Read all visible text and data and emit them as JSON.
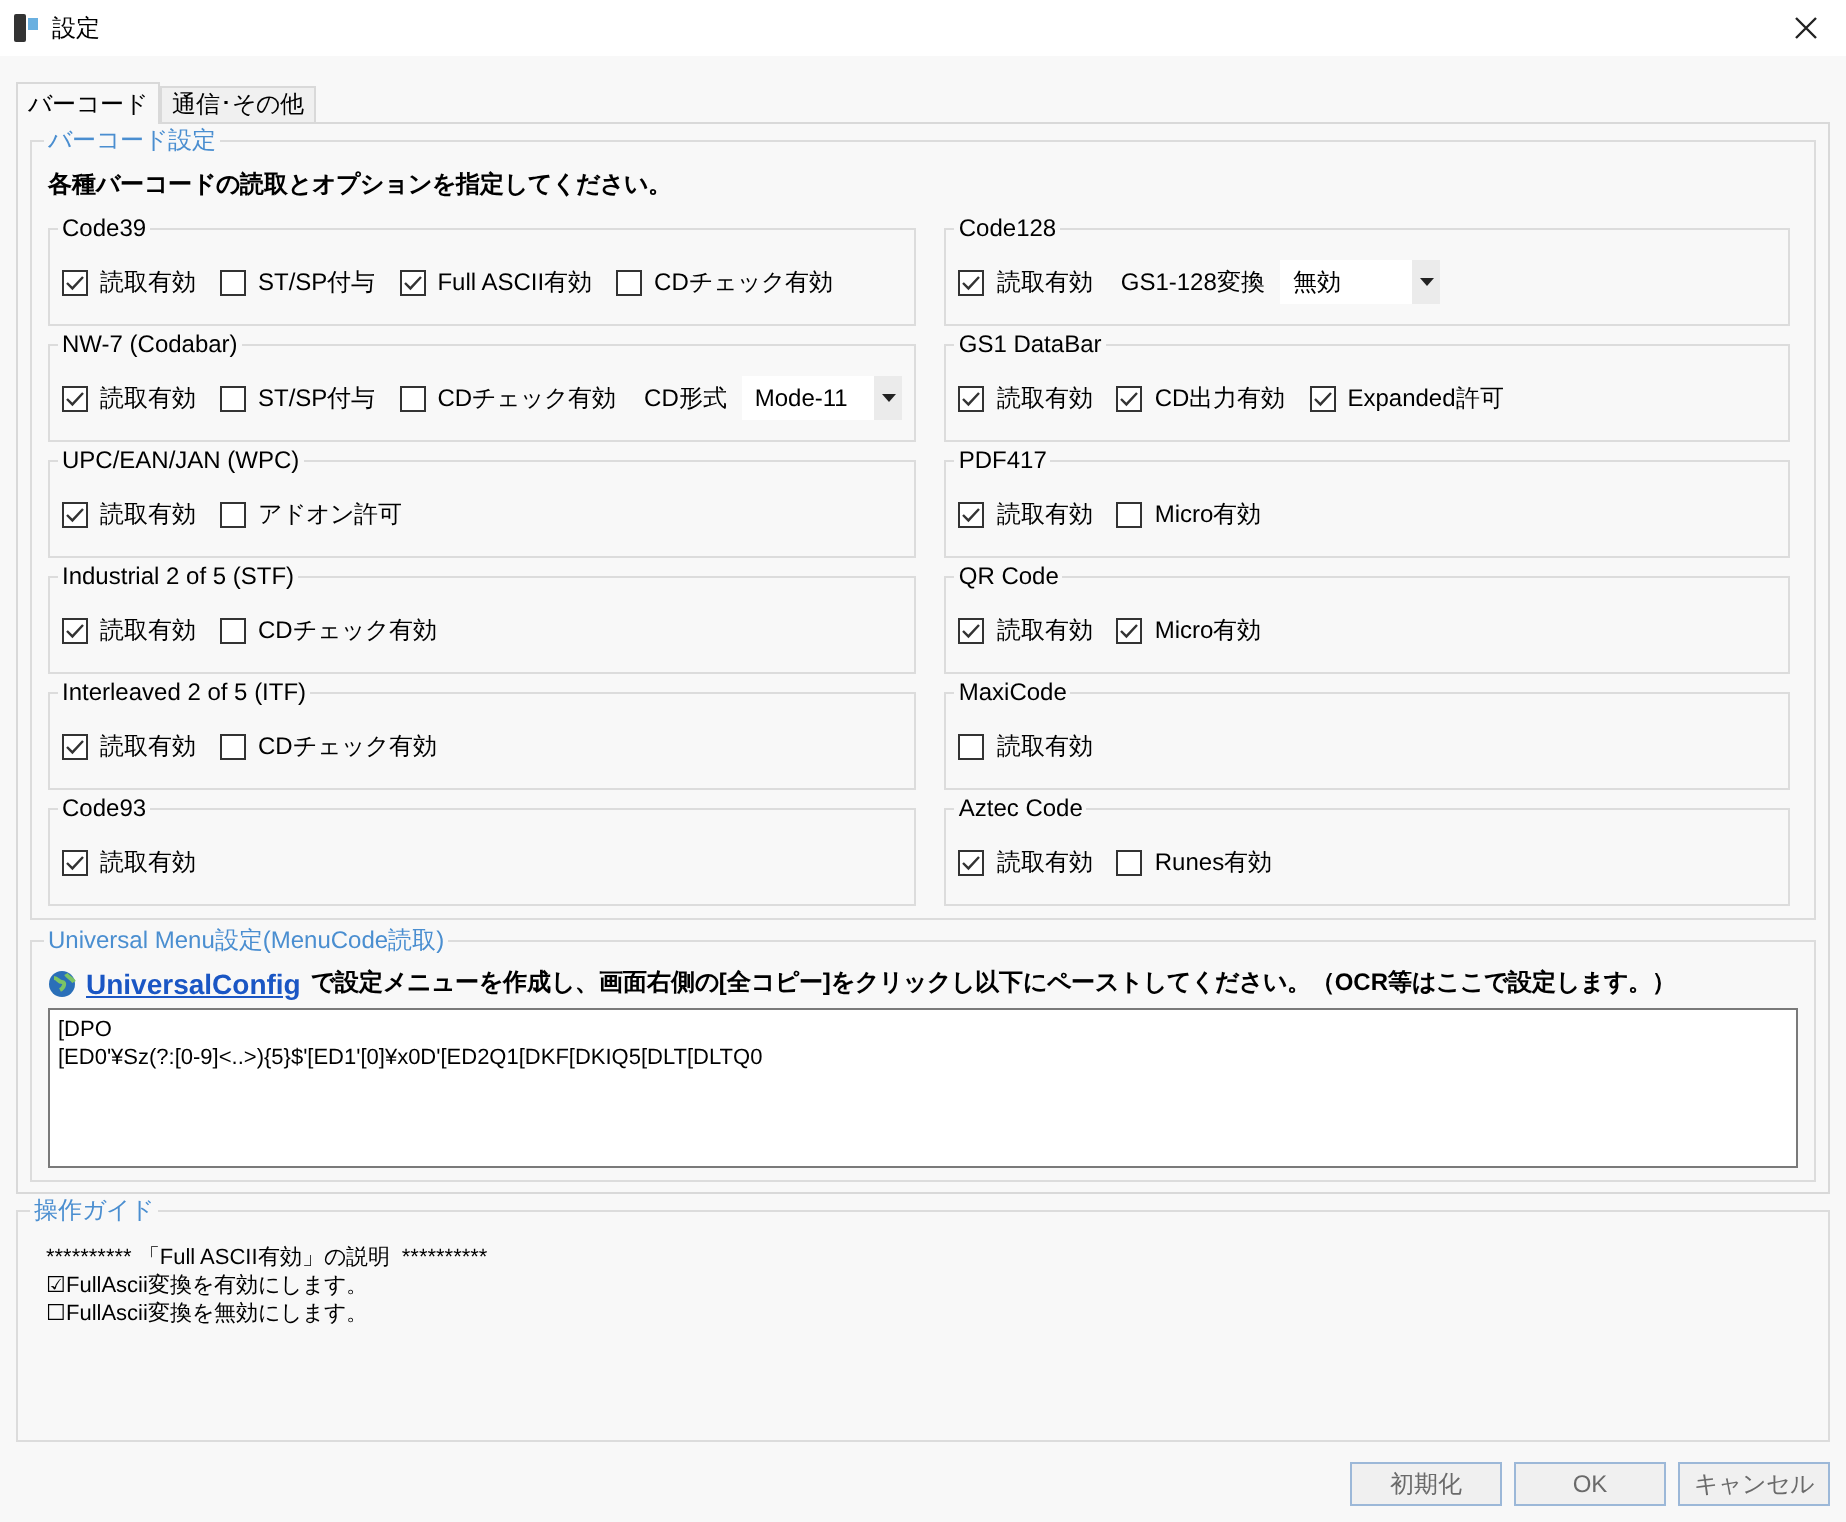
{
  "window": {
    "title": "設定"
  },
  "tabs": [
    {
      "label": "バーコード",
      "selected": true
    },
    {
      "label": "通信･その他",
      "selected": false
    }
  ],
  "barcode_settings": {
    "title": "バーコード設定",
    "instruction": "各種バーコードの読取とオプションを指定してください。",
    "left_groups": [
      {
        "title": "Code39",
        "items": [
          {
            "kind": "checkbox",
            "label": "読取有効",
            "checked": true
          },
          {
            "kind": "checkbox",
            "label": "ST/SP付与",
            "checked": false
          },
          {
            "kind": "checkbox",
            "label": "Full ASCII有効",
            "checked": true
          },
          {
            "kind": "checkbox",
            "label": "CDチェック有効",
            "checked": false
          }
        ]
      },
      {
        "title": "NW-7 (Codabar)",
        "items": [
          {
            "kind": "checkbox",
            "label": "読取有効",
            "checked": true
          },
          {
            "kind": "checkbox",
            "label": "ST/SP付与",
            "checked": false
          },
          {
            "kind": "checkbox",
            "label": "CDチェック有効",
            "checked": false
          },
          {
            "kind": "label",
            "label": "CD形式"
          },
          {
            "kind": "dropdown",
            "value": "Mode-11"
          }
        ]
      },
      {
        "title": "UPC/EAN/JAN (WPC)",
        "items": [
          {
            "kind": "checkbox",
            "label": "読取有効",
            "checked": true
          },
          {
            "kind": "checkbox",
            "label": "アドオン許可",
            "checked": false
          }
        ]
      },
      {
        "title": "Industrial 2 of 5 (STF)",
        "items": [
          {
            "kind": "checkbox",
            "label": "読取有効",
            "checked": true
          },
          {
            "kind": "checkbox",
            "label": "CDチェック有効",
            "checked": false
          }
        ]
      },
      {
        "title": "Interleaved 2 of 5 (ITF)",
        "items": [
          {
            "kind": "checkbox",
            "label": "読取有効",
            "checked": true
          },
          {
            "kind": "checkbox",
            "label": "CDチェック有効",
            "checked": false
          }
        ]
      },
      {
        "title": "Code93",
        "items": [
          {
            "kind": "checkbox",
            "label": "読取有効",
            "checked": true
          }
        ]
      }
    ],
    "right_groups": [
      {
        "title": "Code128",
        "items": [
          {
            "kind": "checkbox",
            "label": "読取有効",
            "checked": true
          },
          {
            "kind": "label",
            "label": "GS1-128変換"
          },
          {
            "kind": "dropdown",
            "value": "無効"
          }
        ]
      },
      {
        "title": "GS1 DataBar",
        "items": [
          {
            "kind": "checkbox",
            "label": "読取有効",
            "checked": true
          },
          {
            "kind": "checkbox",
            "label": "CD出力有効",
            "checked": true
          },
          {
            "kind": "checkbox",
            "label": "Expanded許可",
            "checked": true
          }
        ]
      },
      {
        "title": "PDF417",
        "items": [
          {
            "kind": "checkbox",
            "label": "読取有効",
            "checked": true
          },
          {
            "kind": "checkbox",
            "label": "Micro有効",
            "checked": false
          }
        ]
      },
      {
        "title": "QR Code",
        "items": [
          {
            "kind": "checkbox",
            "label": "読取有効",
            "checked": true
          },
          {
            "kind": "checkbox",
            "label": "Micro有効",
            "checked": true
          }
        ]
      },
      {
        "title": "MaxiCode",
        "items": [
          {
            "kind": "checkbox",
            "label": "読取有効",
            "checked": false
          }
        ]
      },
      {
        "title": "Aztec Code",
        "items": [
          {
            "kind": "checkbox",
            "label": "読取有効",
            "checked": true
          },
          {
            "kind": "checkbox",
            "label": "Runes有効",
            "checked": false
          }
        ]
      }
    ]
  },
  "universal_menu": {
    "title": "Universal Menu設定(MenuCode読取)",
    "link": "UniversalConfig",
    "instruction": "で設定メニューを作成し、画面右側の[全コピー]をクリックし以下にペーストしてください。（OCR等はここで設定します。）",
    "text_lines": [
      "[DPO",
      "[ED0'¥Sz(?:[0-9]<..>){5}$'[ED1'[0]¥x0D'[ED2Q1[DKF[DKIQ5[DLT[DLTQ0"
    ]
  },
  "guide": {
    "title": "操作ガイド",
    "lines": [
      "********** 「Full ASCII有効」の説明  **********",
      "☑FullAscii変換を有効にします。",
      "☐FullAscii変換を無効にします。"
    ]
  },
  "buttons": [
    "初期化",
    "OK",
    "キャンセル"
  ]
}
